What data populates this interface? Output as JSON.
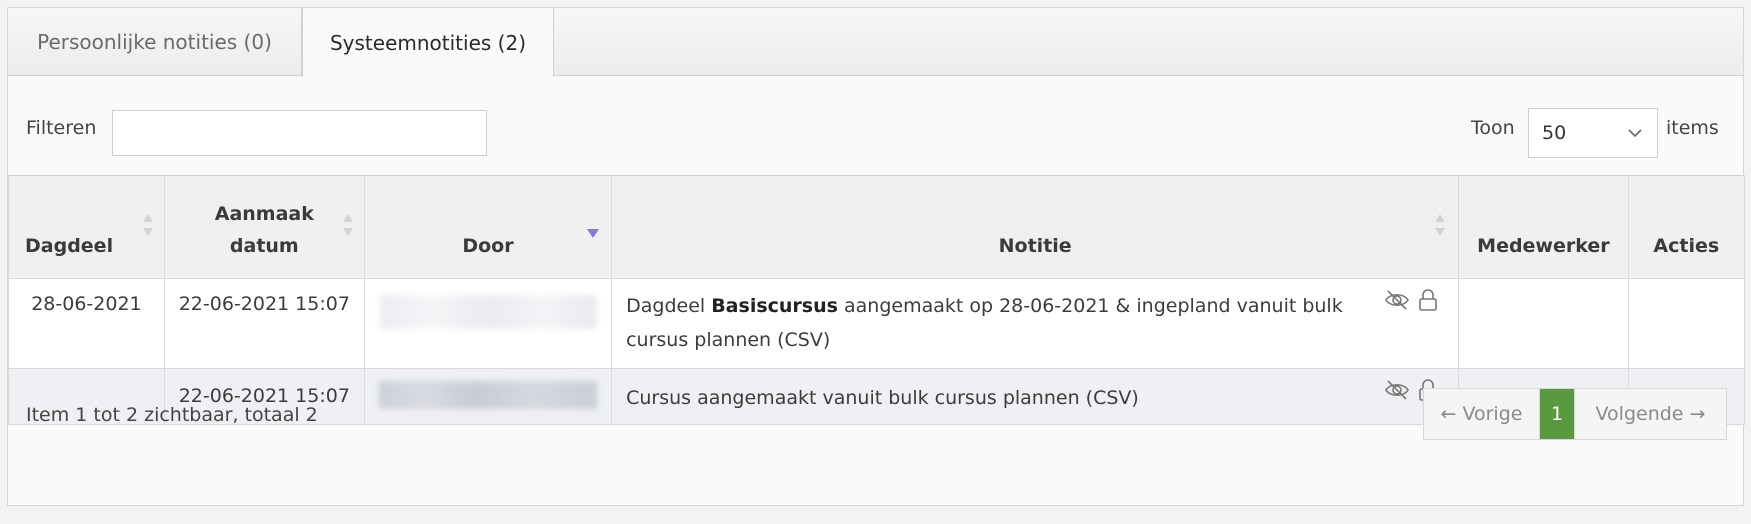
{
  "tabs": [
    {
      "label": "Persoonlijke notities (0)",
      "active": false
    },
    {
      "label": "Systeemnotities (2)",
      "active": true
    }
  ],
  "filter": {
    "label": "Filteren",
    "value": ""
  },
  "page_size": {
    "label_before": "Toon",
    "value": "50",
    "label_after": "items"
  },
  "table": {
    "headers": {
      "dagdeel": "Dagdeel",
      "aanmaak_line1": "Aanmaak",
      "aanmaak_line2": "datum",
      "door": "Door",
      "notitie": "Notitie",
      "medewerker": "Medewerker",
      "acties": "Acties"
    },
    "rows": [
      {
        "dagdeel": "28-06-2021",
        "aanmaakdatum": "22-06-2021 15:07",
        "notitie_prefix": "Dagdeel ",
        "notitie_bold": "Basiscursus",
        "notitie_suffix": " aangemaakt op 28-06-2021 & ingepland vanuit bulk cursus plannen (CSV)",
        "medewerker": "",
        "acties": ""
      },
      {
        "dagdeel": "",
        "aanmaakdatum": "22-06-2021 15:07",
        "notitie_prefix": "Cursus aangemaakt vanuit bulk cursus plannen (CSV)",
        "notitie_bold": "",
        "notitie_suffix": "",
        "medewerker": "",
        "acties": ""
      }
    ]
  },
  "footer": {
    "summary": "Item 1 tot 2 zichtbaar, totaal 2"
  },
  "pagination": {
    "prev": "← Vorige",
    "current": "1",
    "next": "Volgende →"
  },
  "colors": {
    "accent_green": "#5a9a3e",
    "sort_active": "#7b7fd6"
  },
  "icons": [
    "hidden-eye-icon",
    "lock-icon",
    "sort-icon",
    "sort-desc-icon",
    "chevron-down-icon"
  ]
}
